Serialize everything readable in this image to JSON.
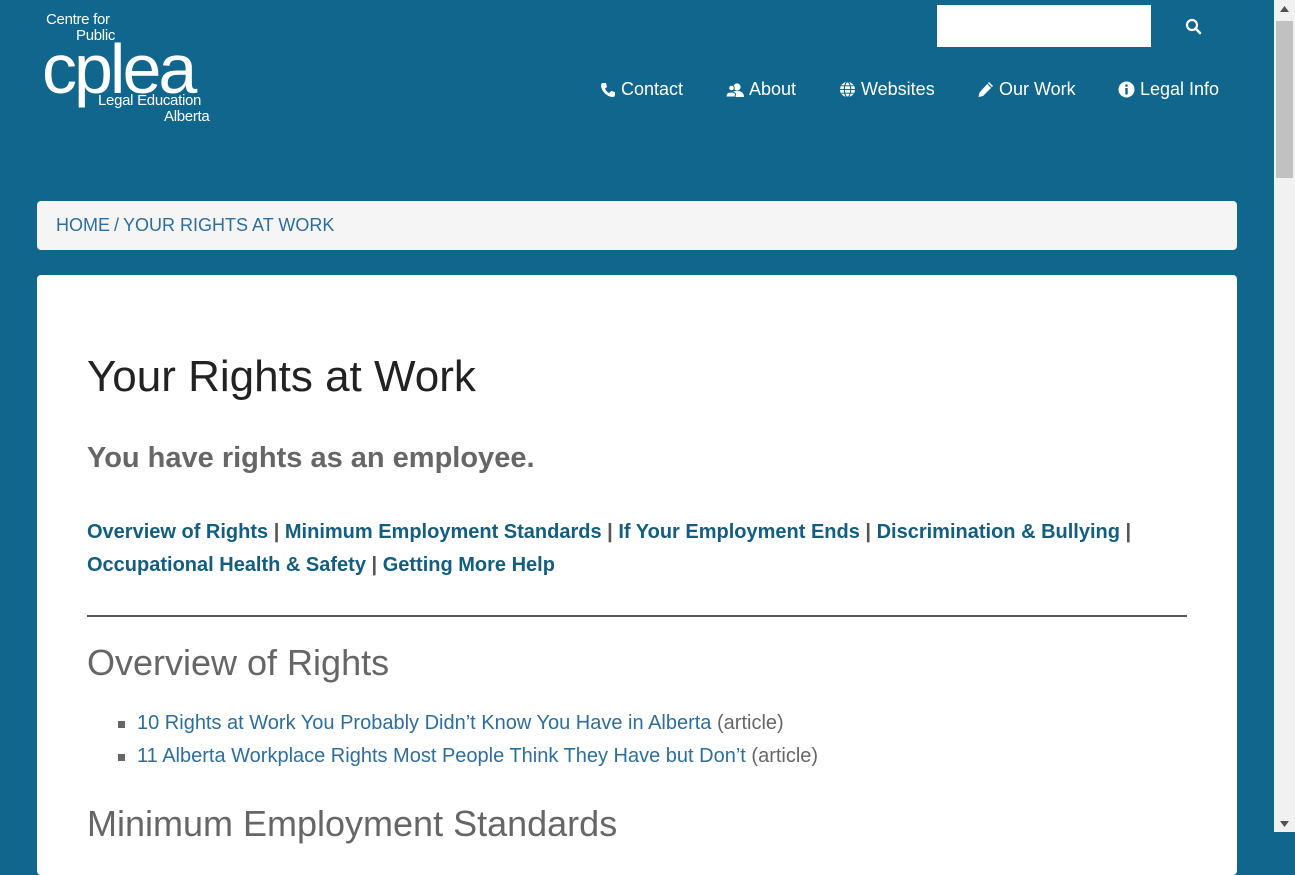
{
  "logo": {
    "line1": "Centre for",
    "line2": "Public",
    "main": "cplea",
    "line3": "Legal Education",
    "line4": "Alberta"
  },
  "search": {
    "value": "",
    "placeholder": "",
    "icon": "search-icon"
  },
  "nav": {
    "items": [
      {
        "label": "Contact",
        "icon": "phone-icon"
      },
      {
        "label": "About",
        "icon": "users-icon"
      },
      {
        "label": "Websites",
        "icon": "globe-icon"
      },
      {
        "label": "Our Work",
        "icon": "pencil-icon"
      },
      {
        "label": "Legal Info",
        "icon": "info-icon"
      }
    ]
  },
  "breadcrumb": {
    "home": "HOME",
    "separator": "/",
    "current": "YOUR RIGHTS AT WORK"
  },
  "page": {
    "title": "Your Rights at Work",
    "subtitle": "You have rights as an employee.",
    "jump_links": [
      "Overview of Rights",
      "Minimum Employment Standards",
      "If Your Employment Ends",
      "Discrimination & Bullying",
      "Occupational Health & Safety",
      "Getting More Help"
    ],
    "jump_separator": "|",
    "sections": [
      {
        "heading": "Overview of Rights",
        "articles": [
          {
            "title": "10 Rights at Work You Probably Didn’t Know You Have in Alberta",
            "type": "(article)"
          },
          {
            "title": "11 Alberta Workplace Rights Most People Think They Have but Don’t",
            "type": "(article)"
          }
        ]
      },
      {
        "heading": "Minimum Employment Standards"
      }
    ]
  },
  "colors": {
    "header_bg": "#10668d",
    "link": "#125d80",
    "breadcrumb_bg": "#f5f5f5"
  }
}
